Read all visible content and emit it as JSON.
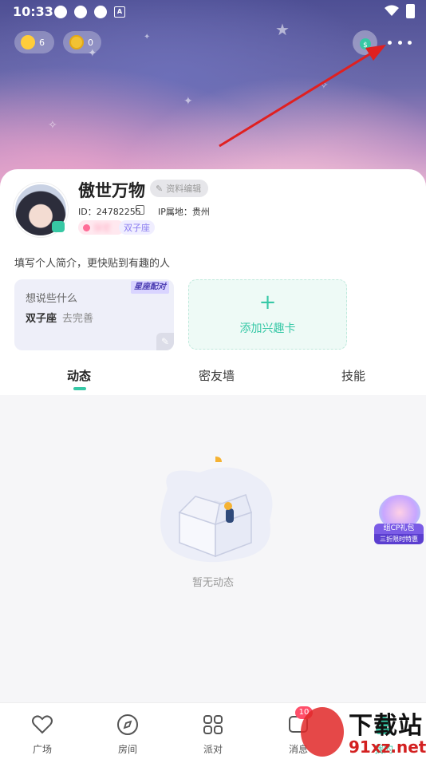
{
  "status_bar": {
    "time": "10:33"
  },
  "top_bar": {
    "likes_count": "6",
    "coins_count": "0"
  },
  "profile": {
    "name": "傲世万物",
    "edit_label": "资料编辑",
    "id_text": "ID：24782255",
    "ip_text": "IP属地：贵州",
    "tag_zodiac": "双子座",
    "tag_gender_blurred": "保密"
  },
  "bio_placeholder": "填写个人简介，更快贴到有趣的人",
  "card_thoughts": {
    "title": "想说些什么",
    "value": "双子座",
    "action": "去完善",
    "corner_tag": "星座配对"
  },
  "card_add": {
    "label": "添加兴趣卡"
  },
  "tabs": [
    {
      "label": "动态",
      "active": true
    },
    {
      "label": "密友墙",
      "active": false
    },
    {
      "label": "技能",
      "active": false
    }
  ],
  "empty_state": {
    "text": "暂无动态"
  },
  "float_badge": {
    "line1": "组CP礼包",
    "line2": "三折限时特惠"
  },
  "bottom_nav": [
    {
      "label": "广场",
      "icon": "heart-icon"
    },
    {
      "label": "房间",
      "icon": "compass-icon"
    },
    {
      "label": "派对",
      "icon": "party-grid-icon"
    },
    {
      "label": "消息",
      "icon": "message-icon",
      "badge": "10"
    },
    {
      "label": "我的",
      "icon": "profile-icon"
    }
  ],
  "watermark": {
    "line1": "下载站",
    "line2": "91xz.net"
  },
  "colors": {
    "accent": "#36c8a6",
    "arrow": "#e02020",
    "tag_zodiac": "#8a7cf0"
  }
}
